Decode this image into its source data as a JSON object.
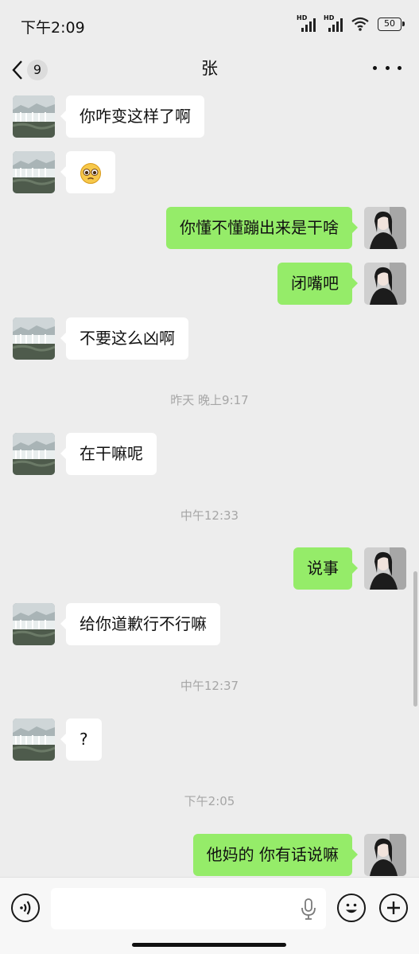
{
  "status_bar": {
    "time": "下午2:09",
    "signal1_label": "HD",
    "signal2_label": "HD",
    "battery": "50"
  },
  "header": {
    "back_icon": "chevron-left-icon",
    "unread_count": "9",
    "title": "张",
    "more_icon": "more-dots-icon"
  },
  "messages": [
    {
      "from": "contact",
      "text": "你咋变这样了啊"
    },
    {
      "from": "contact",
      "text": "🥺"
    },
    {
      "from": "me",
      "text": "你懂不懂蹦出来是干啥"
    },
    {
      "from": "me",
      "text": "闭嘴吧"
    },
    {
      "from": "contact",
      "text": "不要这么凶啊"
    },
    {
      "timestamp": "昨天 晚上9:17"
    },
    {
      "from": "contact",
      "text": "在干嘛呢"
    },
    {
      "timestamp": "中午12:33"
    },
    {
      "from": "me",
      "text": "说事"
    },
    {
      "from": "contact",
      "text": "给你道歉行不行嘛"
    },
    {
      "timestamp": "中午12:37"
    },
    {
      "from": "contact",
      "text": "?"
    },
    {
      "timestamp": "下午2:05"
    },
    {
      "from": "me",
      "text": "他妈的 你有话说嘛"
    }
  ],
  "input_bar": {
    "voice_icon": "voice-icon",
    "input_value": "",
    "mic_icon": "microphone-icon",
    "emoji_icon": "emoji-icon",
    "plus_icon": "plus-icon"
  },
  "colors": {
    "background": "#ededed",
    "outgoing_bubble": "#95ec69",
    "incoming_bubble": "#ffffff",
    "timestamp": "#a6a6a6"
  }
}
